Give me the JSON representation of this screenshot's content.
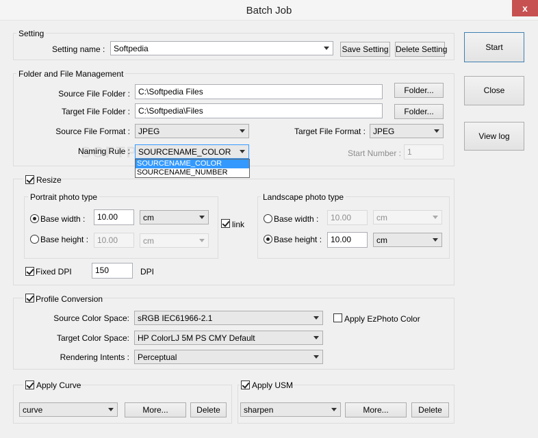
{
  "window": {
    "title": "Batch Job",
    "close_glyph": "x"
  },
  "setting": {
    "legend": "Setting",
    "name_label": "Setting name :",
    "name_value": "Softpedia",
    "save_label": "Save Setting",
    "delete_label": "Delete Setting"
  },
  "folder": {
    "legend": "Folder and File Management",
    "source_folder_label": "Source File Folder :",
    "source_folder_value": "C:\\Softpedia Files",
    "target_folder_label": "Target File Folder :",
    "target_folder_value": "C:\\Softpedia\\Files",
    "folder_button": "Folder...",
    "source_format_label": "Source File Format :",
    "source_format_value": "JPEG",
    "target_format_label": "Target File Format :",
    "target_format_value": "JPEG",
    "naming_rule_label": "Naming Rule :",
    "naming_rule_value": "SOURCENAME_COLOR",
    "naming_options": [
      "SOURCENAME_COLOR",
      "SOURCENAME_NUMBER"
    ],
    "start_number_label": "Start Number :",
    "start_number_value": "1",
    "watermark": "SOFTPEDIA"
  },
  "resize": {
    "label": "Resize",
    "checked": true,
    "portrait": {
      "legend": "Portrait photo type",
      "base_width_label": "Base width :",
      "base_width_value": "10.00",
      "base_width_unit": "cm",
      "base_height_label": "Base height :",
      "base_height_value": "10.00",
      "base_height_unit": "cm",
      "selected": "width"
    },
    "link_label": "link",
    "link_checked": true,
    "landscape": {
      "legend": "Landscape photo type",
      "base_width_label": "Base width :",
      "base_width_value": "10.00",
      "base_width_unit": "cm",
      "base_height_label": "Base height :",
      "base_height_value": "10.00",
      "base_height_unit": "cm",
      "selected": "height"
    },
    "fixed_dpi_label": "Fixed DPI",
    "fixed_dpi_checked": true,
    "dpi_value": "150",
    "dpi_unit": "DPI"
  },
  "profile": {
    "label": "Profile Conversion",
    "checked": true,
    "source_label": "Source Color Space:",
    "source_value": "sRGB IEC61966-2.1",
    "ezphoto_label": "Apply EzPhoto Color",
    "ezphoto_checked": false,
    "target_label": "Target Color Space:",
    "target_value": "HP ColorLJ 5M PS CMY Default",
    "intent_label": "Rendering Intents :",
    "intent_value": "Perceptual"
  },
  "curve": {
    "label": "Apply Curve",
    "checked": true,
    "value": "curve",
    "more_label": "More...",
    "delete_label": "Delete"
  },
  "usm": {
    "label": "Apply USM",
    "checked": true,
    "value": "sharpen",
    "more_label": "More...",
    "delete_label": "Delete"
  },
  "side": {
    "start_label": "Start",
    "close_label": "Close",
    "viewlog_label": "View log"
  }
}
